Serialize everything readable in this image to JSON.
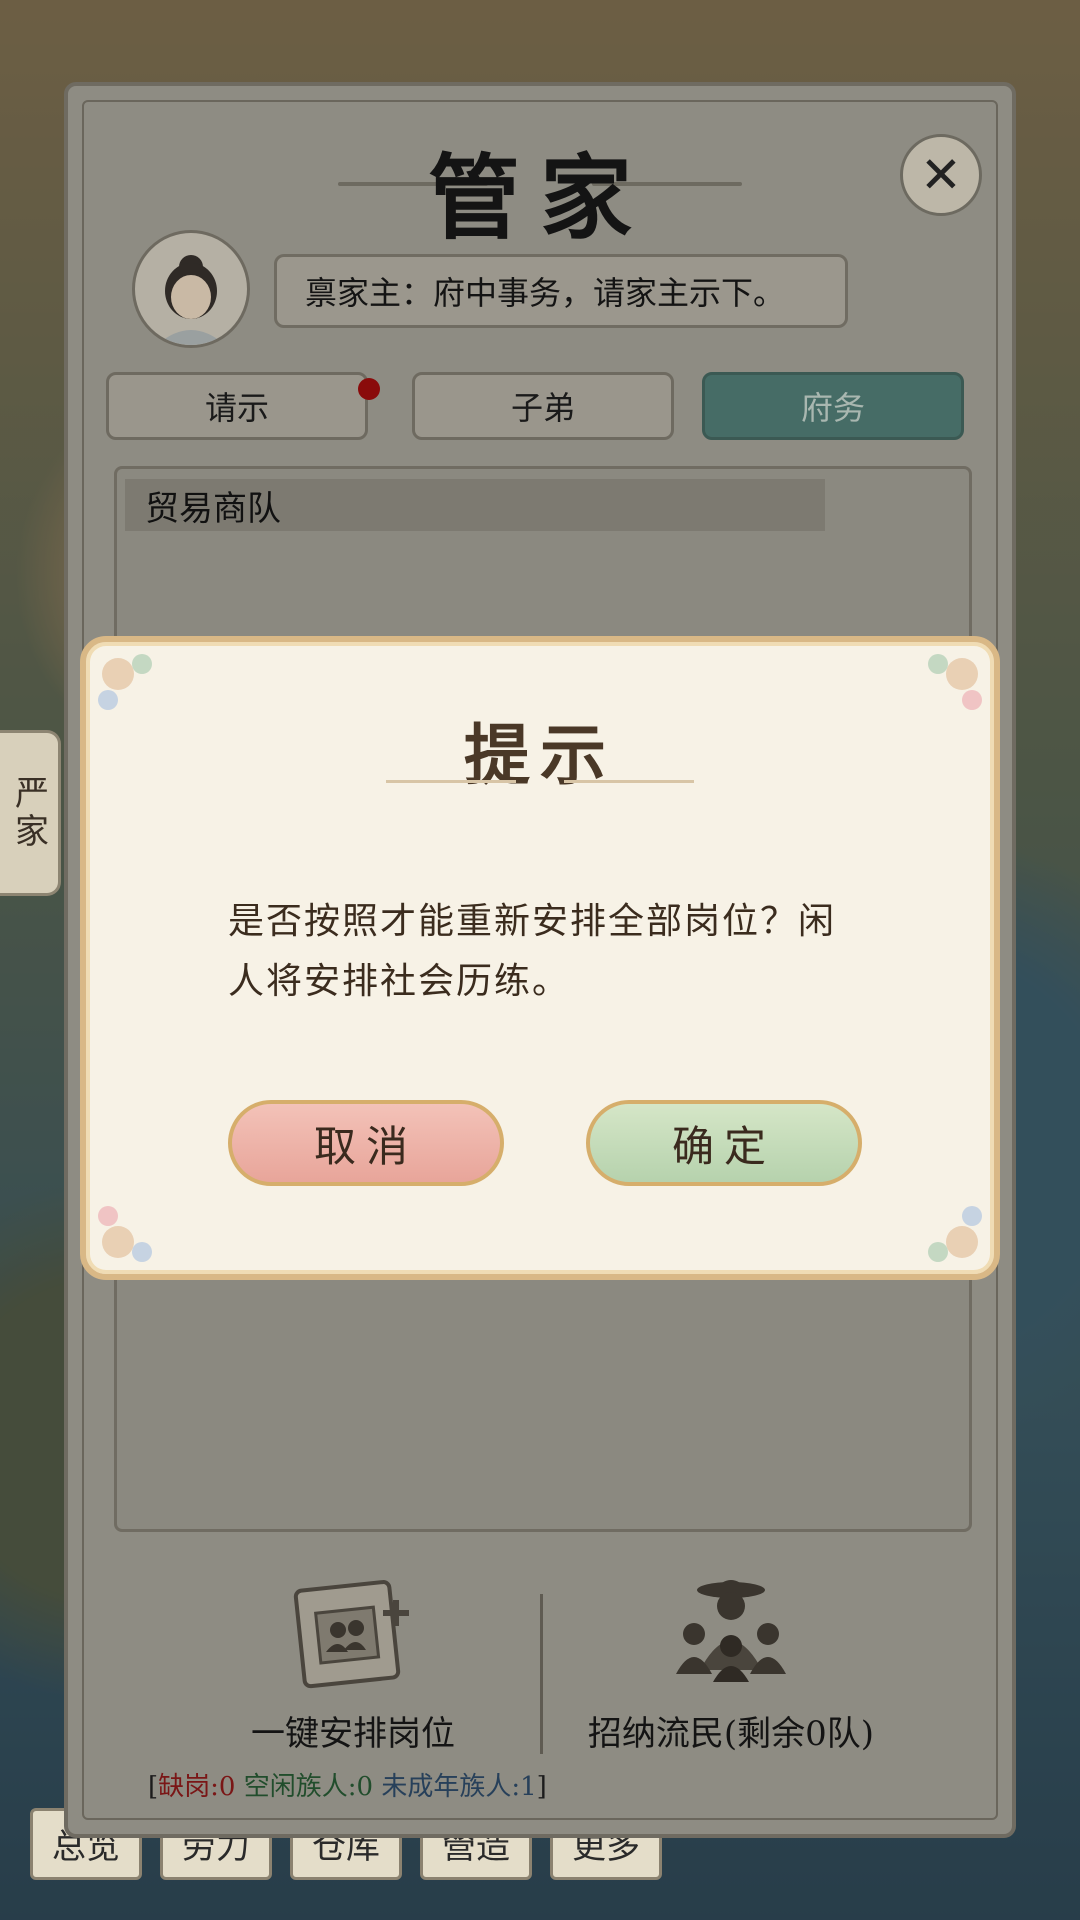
{
  "bottom_tabs": [
    "总览",
    "劳力",
    "仓库",
    "營造",
    "更多"
  ],
  "side_tab": "严家",
  "panel": {
    "title": "管家",
    "close_icon": "close-icon",
    "speech": "禀家主：府中事务，请家主示下。",
    "tabs": [
      {
        "label": "请示",
        "active": false,
        "has_notification": true
      },
      {
        "label": "子弟",
        "active": false,
        "has_notification": false
      },
      {
        "label": "府务",
        "active": true,
        "has_notification": false
      }
    ],
    "list_header": "贸易商队"
  },
  "actions": {
    "assign": {
      "label": "一键安排岗位",
      "icon": "scroll-people-icon"
    },
    "recruit": {
      "label": "招纳流民(剩余0队)",
      "icon": "refugees-icon"
    }
  },
  "status": {
    "open_bracket": "[",
    "vacancy": "缺岗:0",
    "idle": "空闲族人:0",
    "minor": "未成年族人:1",
    "close_bracket": "]"
  },
  "dialog": {
    "title": "提示",
    "message": "是否按照才能重新安排全部岗位？闲人将安排社会历练。",
    "cancel_label": "取消",
    "confirm_label": "确定"
  },
  "colors": {
    "active_tab": "#466c66",
    "cancel_button": "#e8a59a",
    "confirm_button": "#b6d2ad",
    "dialog_border": "#d9b886"
  }
}
